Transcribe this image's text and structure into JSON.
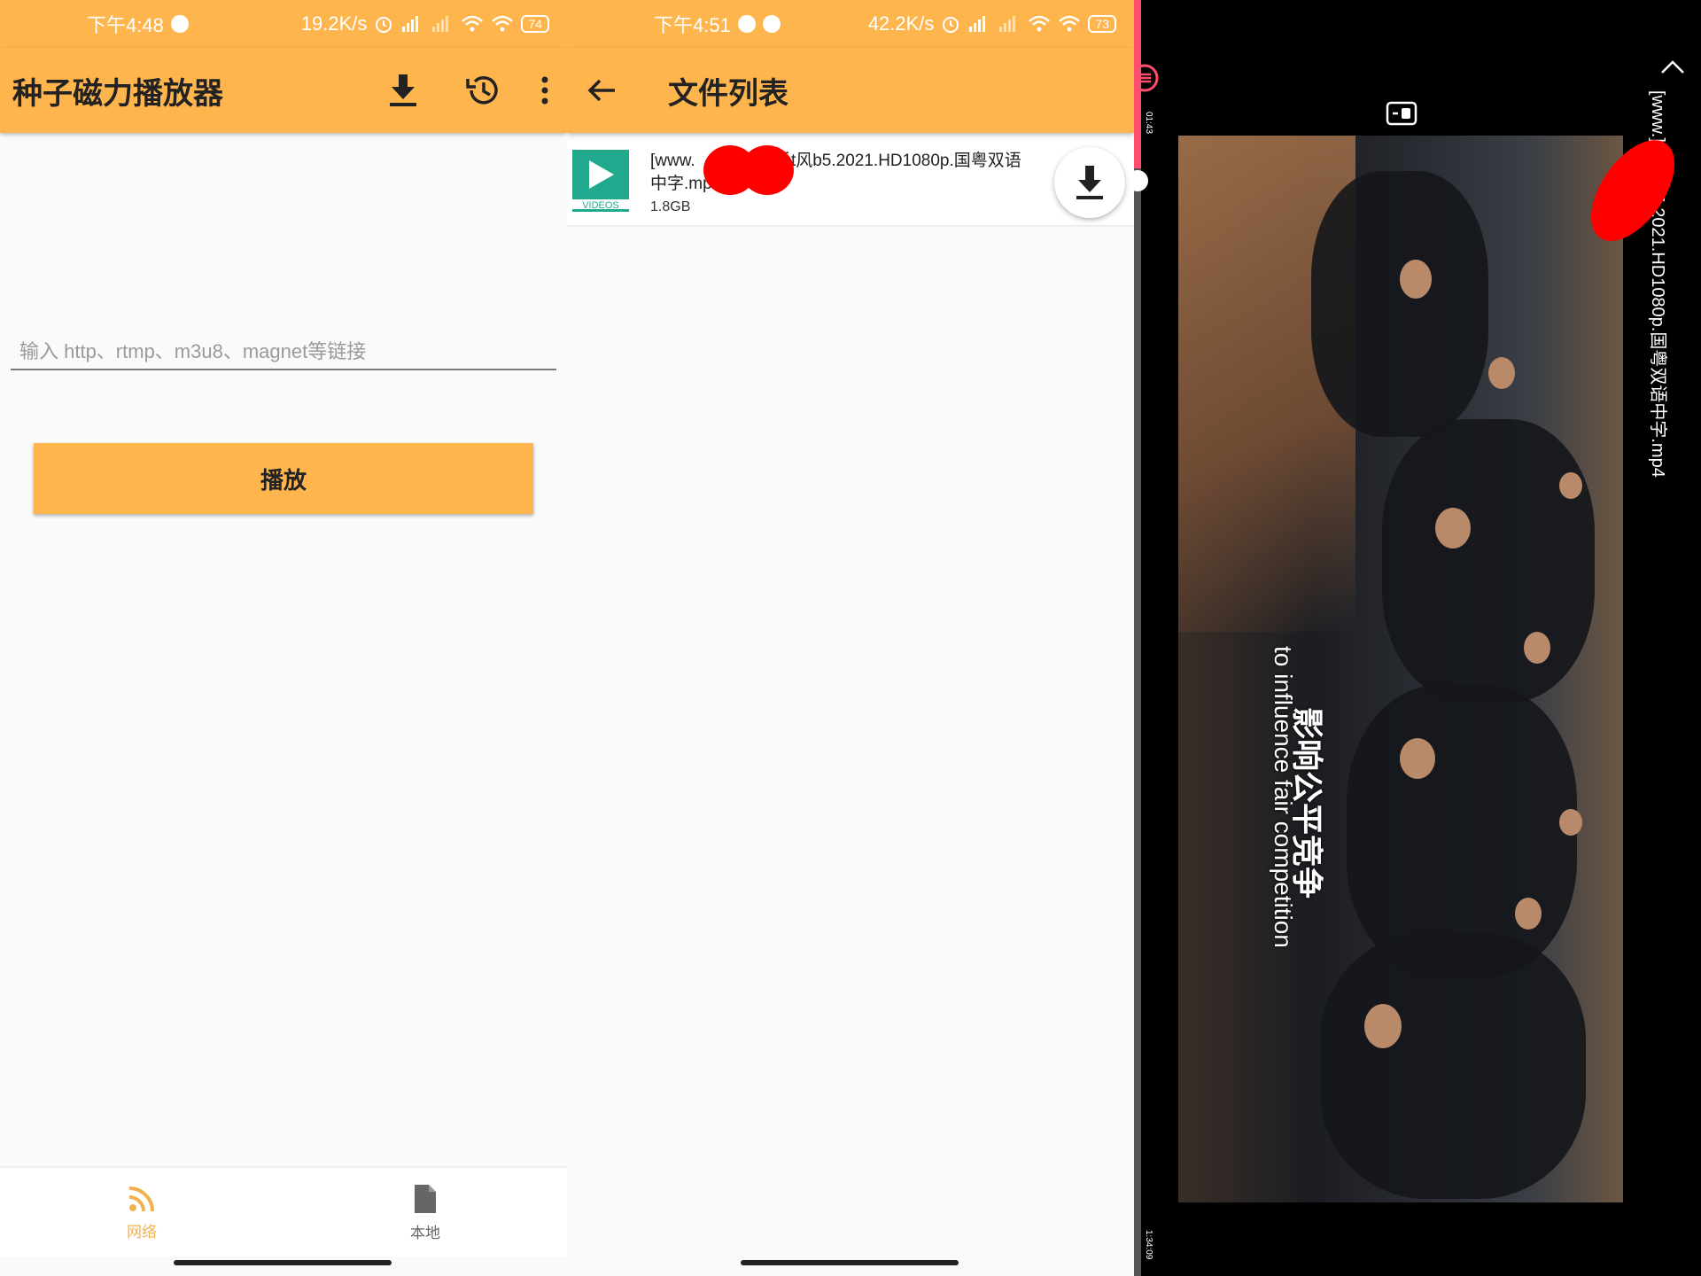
{
  "panel1": {
    "status": {
      "time": "下午4:48",
      "speed": "19.2K/s",
      "battery": "74"
    },
    "app_title": "种子磁力播放器",
    "url_placeholder": "输入 http、rtmp、m3u8、magnet等链接",
    "play_button": "播放",
    "nav": [
      {
        "label": "网络",
        "icon": "rss-icon",
        "active": true
      },
      {
        "label": "本地",
        "icon": "file-icon",
        "active": false
      }
    ],
    "colors": {
      "accent": "#ffb54d",
      "nav_active": "#f2b14f"
    }
  },
  "panel2": {
    "status": {
      "time": "下午4:51",
      "speed": "42.2K/s",
      "battery": "73"
    },
    "title": "文件列表",
    "file": {
      "name_prefix": "[www.",
      "name_suffix": "]反t风b5.2021.HD1080p.国粤双语",
      "name_line2": "中字.mp4",
      "size": "1.8GB",
      "thumb_label": "VIDEOS"
    }
  },
  "panel3": {
    "video_title": "[www.]反t风b5.2021.HD1080p.国粤双语中字.mp4",
    "subtitle_cn": "影响公平竞争",
    "subtitle_en": "to influence fair competition",
    "time_elapsed": "01:43",
    "time_total": "1:34:09"
  }
}
